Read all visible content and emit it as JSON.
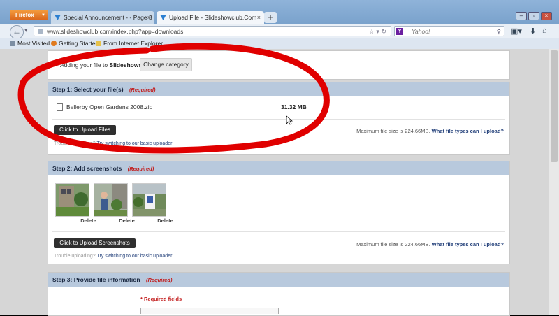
{
  "browser": {
    "app_button": "Firefox",
    "tabs": [
      {
        "title": "Special Announcement - - Page 3 - ...",
        "active": false
      },
      {
        "title": "Upload File - Slideshowclub.Com",
        "active": true
      }
    ],
    "url": "www.slideshowclub.com/index.php?app=downloads",
    "search_placeholder": "Yahoo!",
    "search_engine_letter": "Y",
    "bookmarks": [
      "Most Visited",
      "Getting Started",
      "From Internet Explorer"
    ]
  },
  "page": {
    "category": {
      "prefix": "Adding your file to",
      "name": "Slideshows",
      "suffix": ".",
      "change_button": "Change category"
    },
    "step1": {
      "title": "Step 1: Select your file(s)",
      "required": "(Required)",
      "file_name": "Bellerby Open Gardens 2008.zip",
      "file_size": "31.32 MB",
      "upload_button": "Click to Upload Files",
      "max_size_text": "Maximum file size is 224.66MB.",
      "file_types_link": "What file types can I upload?",
      "trouble_text": "Trouble uploading?",
      "basic_link": "Try switching to our basic uploader"
    },
    "step2": {
      "title": "Step 2: Add screenshots",
      "required": "(Required)",
      "screenshots": [
        {
          "delete_label": "Delete"
        },
        {
          "delete_label": "Delete"
        },
        {
          "delete_label": "Delete"
        }
      ],
      "upload_button": "Click to Upload Screenshots",
      "max_size_text": "Maximum file size is 224.66MB.",
      "file_types_link": "What file types can I upload?",
      "trouble_text": "Trouble uploading?",
      "basic_link": "Try switching to our basic uploader"
    },
    "step3": {
      "title": "Step 3: Provide file information",
      "required": "(Required)",
      "required_fields": "* Required fields"
    }
  },
  "colors": {
    "annotation_marker": "#e00000",
    "section_header": "#b8c9dd",
    "required_red": "#c21a1a",
    "link_blue": "#23407a"
  }
}
